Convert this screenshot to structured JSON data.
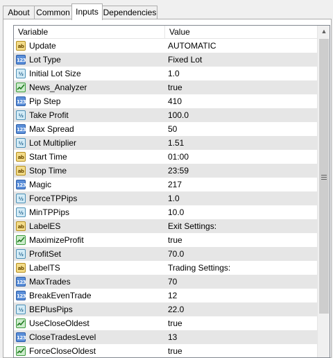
{
  "tabs": [
    {
      "label": "About",
      "active": false
    },
    {
      "label": "Common",
      "active": false
    },
    {
      "label": "Inputs",
      "active": true
    },
    {
      "label": "Dependencies",
      "active": false
    }
  ],
  "table": {
    "columns": {
      "variable": "Variable",
      "value": "Value"
    },
    "rows": [
      {
        "name": "Update",
        "value": "AUTOMATIC",
        "type": "ab"
      },
      {
        "name": "Lot Type",
        "value": "Fixed Lot",
        "type": "123"
      },
      {
        "name": "Initial Lot Size",
        "value": "1.0",
        "type": "v2"
      },
      {
        "name": "News_Analyzer",
        "value": "true",
        "type": "bool"
      },
      {
        "name": "Pip Step",
        "value": "410",
        "type": "123"
      },
      {
        "name": "Take Profit",
        "value": "100.0",
        "type": "v2"
      },
      {
        "name": "Max Spread",
        "value": "50",
        "type": "123"
      },
      {
        "name": "Lot Multiplier",
        "value": "1.51",
        "type": "v2"
      },
      {
        "name": "Start Time",
        "value": "01:00",
        "type": "ab"
      },
      {
        "name": "Stop Time",
        "value": "23:59",
        "type": "ab"
      },
      {
        "name": "Magic",
        "value": "217",
        "type": "123"
      },
      {
        "name": "ForceTPPips",
        "value": "1.0",
        "type": "v2"
      },
      {
        "name": "MinTPPips",
        "value": "10.0",
        "type": "v2"
      },
      {
        "name": "LabelES",
        "value": "Exit Settings:",
        "type": "ab"
      },
      {
        "name": "MaximizeProfit",
        "value": "true",
        "type": "bool"
      },
      {
        "name": "ProfitSet",
        "value": "70.0",
        "type": "v2"
      },
      {
        "name": "LabelTS",
        "value": "Trading Settings:",
        "type": "ab"
      },
      {
        "name": "MaxTrades",
        "value": "70",
        "type": "123"
      },
      {
        "name": "BreakEvenTrade",
        "value": "12",
        "type": "123"
      },
      {
        "name": "BEPlusPips",
        "value": "22.0",
        "type": "v2"
      },
      {
        "name": "UseCloseOldest",
        "value": "true",
        "type": "bool"
      },
      {
        "name": "CloseTradesLevel",
        "value": "13",
        "type": "123"
      },
      {
        "name": "ForceCloseOldest",
        "value": "true",
        "type": "bool"
      }
    ]
  },
  "icons": {
    "ab": {
      "name": "string-type-icon",
      "glyph": "ab"
    },
    "123": {
      "name": "integer-type-icon",
      "glyph": "123"
    },
    "v2": {
      "name": "double-type-icon",
      "glyph": "½"
    },
    "bool": {
      "name": "boolean-type-icon",
      "glyph": ""
    }
  },
  "scrollbar": {
    "up": "▲",
    "position": 0,
    "visible_fraction": 0.88
  }
}
